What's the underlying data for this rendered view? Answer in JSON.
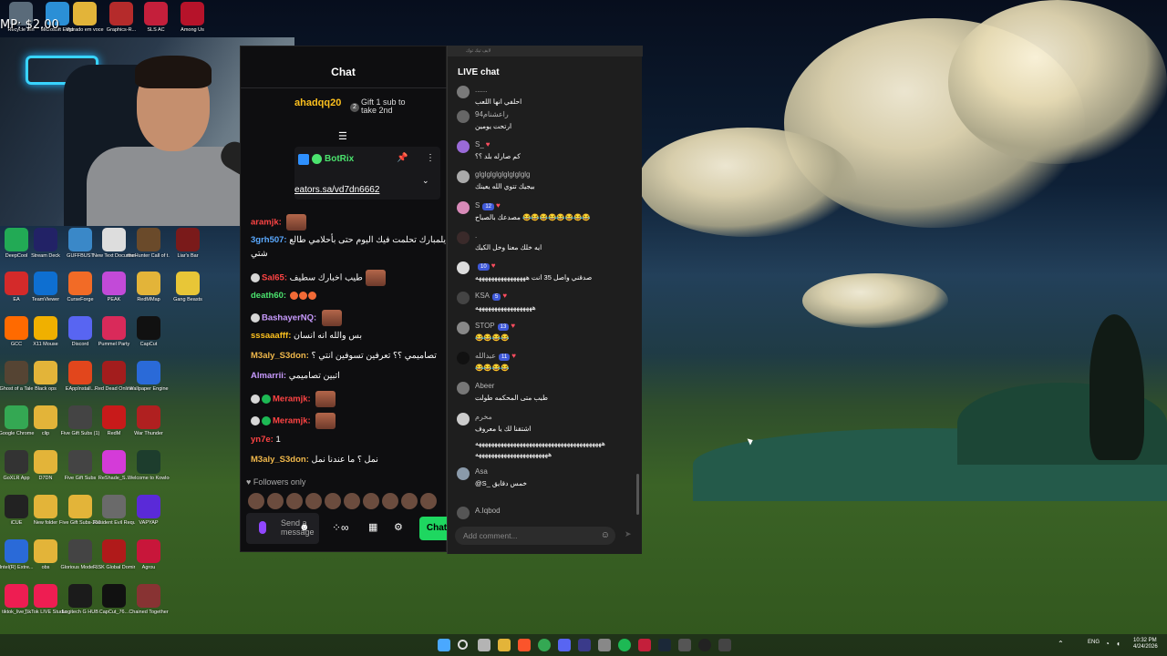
{
  "desktop_top_icons": [
    {
      "label": "Recycle Bin",
      "color": "#5a6b7a"
    },
    {
      "label": "Microsoft Edge",
      "color": "#2b8fd6"
    },
    {
      "label": "Vidrado em voce",
      "color": "#e3b439"
    },
    {
      "label": "Graphics-R...",
      "color": "#b52b2b"
    },
    {
      "label": "SLS AC",
      "color": "#c41f3b"
    },
    {
      "label": "Among Us",
      "color": "#b6132a"
    }
  ],
  "desktop_icons": [
    {
      "label": "DeepCool",
      "color": "#22aa55"
    },
    {
      "label": "Stream Deck",
      "color": "#222266"
    },
    {
      "label": "GUFFBUST",
      "color": "#3a88c8"
    },
    {
      "label": "New Text Document",
      "color": "#dddddd"
    },
    {
      "label": "theHunter Call of t...",
      "color": "#6a4a2a"
    },
    {
      "label": "Liar's Bar",
      "color": "#7a1a1a"
    },
    {
      "label": "EA",
      "color": "#d42a2a"
    },
    {
      "label": "TeamViewer",
      "color": "#0e6fd1"
    },
    {
      "label": "CurseForge",
      "color": "#f26b26"
    },
    {
      "label": "PEAK",
      "color": "#c24ad8"
    },
    {
      "label": "RedMMap",
      "color": "#e3b439"
    },
    {
      "label": "Gang Beasts",
      "color": "#e8c637"
    },
    {
      "label": "GCC",
      "color": "#ff6a00"
    },
    {
      "label": "X11 Mouse",
      "color": "#f0b000"
    },
    {
      "label": "Discord",
      "color": "#5865f2"
    },
    {
      "label": "Pummel Party",
      "color": "#d92a5a"
    },
    {
      "label": "CapCut",
      "color": "#111111"
    },
    {
      "label": "Ghost of a Tale",
      "color": "#554433"
    },
    {
      "label": "Black ops",
      "color": "#e3b439"
    },
    {
      "label": "EAppInstall...",
      "color": "#e2461c"
    },
    {
      "label": "Red Dead Online",
      "color": "#a31d1d"
    },
    {
      "label": "Wallpaper Engine",
      "color": "#2a6ad8"
    },
    {
      "label": "Google Chrome",
      "color": "#34a853"
    },
    {
      "label": "clip",
      "color": "#e3b439"
    },
    {
      "label": "Five Gift Subs (1)",
      "color": "#444444"
    },
    {
      "label": "RedM",
      "color": "#c81a1a"
    },
    {
      "label": "War Thunder",
      "color": "#b02020"
    },
    {
      "label": "GoXLR App",
      "color": "#333333"
    },
    {
      "label": "D7DN",
      "color": "#e3b439"
    },
    {
      "label": "Five Gift Subs",
      "color": "#444444"
    },
    {
      "label": "ReShade_S...",
      "color": "#d43bd8"
    },
    {
      "label": "Welcome to Kowloon",
      "color": "#1d3d2d"
    },
    {
      "label": "iCUE",
      "color": "#222222"
    },
    {
      "label": "New folder",
      "color": "#e3b439"
    },
    {
      "label": "Five Gift Subs-2025...",
      "color": "#e3b439"
    },
    {
      "label": "Resident Evil Requiem",
      "color": "#6a6a6a"
    },
    {
      "label": "VAPYAP",
      "color": "#5a2ad8"
    },
    {
      "label": "Intel(R) Extre...",
      "color": "#2a6ad8"
    },
    {
      "label": "obs",
      "color": "#e3b439"
    },
    {
      "label": "Glorious Model ...",
      "color": "#444444"
    },
    {
      "label": "RISK Global Domination",
      "color": "#b01a1a"
    },
    {
      "label": "Agrou",
      "color": "#c8163a"
    },
    {
      "label": "tiktok_live_...",
      "color": "#ee1d52"
    },
    {
      "label": "TikTok LIVE Studio",
      "color": "#ee1d52"
    },
    {
      "label": "Logitech G HUB",
      "color": "#1b1b1b"
    },
    {
      "label": "CapCut_76...",
      "color": "#111111"
    },
    {
      "label": "Chained Together",
      "color": "#883333"
    }
  ],
  "webcam": {
    "overlay_text": "MP: $2.00"
  },
  "twitch_chat": {
    "title": "Chat",
    "gift_user": "ahadqq20",
    "gift_number": "2",
    "gift_text_1": "Gift 1 sub to",
    "gift_text_2": "take 2nd",
    "pinned_user": "BotRix",
    "pinned_link": "eators.sa/vd7dn6662",
    "messages": [
      {
        "name": "aramjk:",
        "color": "#ff4444",
        "text": ""
      },
      {
        "name": "3grh507:",
        "color": "#5aa9ff",
        "text": "يلمبارك تحلمت فيك اليوم حتى بأحلامي طالع"
      },
      {
        "name": "",
        "color": "#ffffff",
        "text": "شتي"
      },
      {
        "name": "Sal65:",
        "color": "#ff4444",
        "text": "طيب اخبارك سطيف"
      },
      {
        "name": "death60:",
        "color": "#4be36e",
        "text": ""
      },
      {
        "name": "BashayerNQ:",
        "color": "#c99bff",
        "text": ""
      },
      {
        "name": "sssaaafff:",
        "color": "#fcc01e",
        "text": "بس والله انه انسان"
      },
      {
        "name": "M3aly_S3don:",
        "color": "#f0b84b",
        "text": "تصاميمي ؟؟ تعرفين تسوفين انتي ؟"
      },
      {
        "name": "Almarrii:",
        "color": "#c99bff",
        "text": "اتبين تصاميمي"
      },
      {
        "name": "Meramjk:",
        "color": "#ff4444",
        "text": ""
      },
      {
        "name": "Meramjk:",
        "color": "#ff4444",
        "text": ""
      },
      {
        "name": "yn7e:",
        "color": "#ff4444",
        "text": "1"
      },
      {
        "name": "M3aly_S3don:",
        "color": "#f0b84b",
        "text": "نمل ؟ ما عندنا نمل"
      }
    ],
    "followers_only": "Followers only",
    "send_placeholder_1": "Send a",
    "send_placeholder_2": "message",
    "chat_button": "Chat"
  },
  "live_chat": {
    "window_label": "لايف تيك توك",
    "title": "LIVE chat",
    "messages": [
      {
        "name": "......",
        "badge": "",
        "text": "احلفي انها اللعب",
        "avatar": "#7a7a7a"
      },
      {
        "name": "راعشنام94",
        "badge": "",
        "text": "ارتحت يومين",
        "avatar": "#666666"
      },
      {
        "name": "S_",
        "badge": "♥",
        "text": "كم صارله بلد ؟؟",
        "avatar": "#9a6ad8"
      },
      {
        "name": "glglglglglglglglglg",
        "badge": "",
        "text": "بيجيك تتوي الله يعينك",
        "avatar": "#aaaaaa"
      },
      {
        "name": "S",
        "badge": "12",
        "text": "مصدعك بالصباح 😂😂😂😂😂😂😂😂",
        "avatar": "#d88ab8"
      },
      {
        "name": "‌.",
        "badge": "",
        "text": "ايه خلك معنا وخل الكيك",
        "avatar": "#3a2a2a"
      },
      {
        "name": "",
        "badge": "10",
        "text": "صدقني واصل 35 انت ههههههههههههههههه",
        "avatar": "#dddddd"
      },
      {
        "name": "KSA",
        "badge": "5",
        "text": "ههههههههههههههههههه",
        "avatar": "#444444"
      },
      {
        "name": "STOP",
        "badge": "13",
        "text": "😂😂😂😂",
        "avatar": "#888888"
      },
      {
        "name": "عبدالله",
        "badge": "11",
        "text": "😂😂😂😂",
        "avatar": "#111111"
      },
      {
        "name": "Abeer",
        "badge": "",
        "text": "طيب متى المحكمه طولت",
        "avatar": "#777777"
      },
      {
        "name": "مخرم",
        "badge": "",
        "text": "اشتقنا لك يا معروف",
        "avatar": "#cccccc"
      },
      {
        "name": "",
        "badge": "",
        "text": "ههههههههههههههههههههههههههههههههههههههههه",
        "avatar": "#cccccc"
      },
      {
        "name": "",
        "badge": "",
        "text": "هههههههههههههههههههههههه",
        "avatar": "#cccccc"
      },
      {
        "name": "Asa",
        "badge": "",
        "text": "@S_ خمس دقايق",
        "avatar": "#8a9aaa"
      },
      {
        "name": "A.Iqbod",
        "badge": "",
        "text": "",
        "avatar": "#555555"
      }
    ],
    "comment_placeholder": "Add comment..."
  },
  "taskbar": {
    "lang": "ENG",
    "time": "10:32 PM",
    "date": "4/24/2026"
  }
}
